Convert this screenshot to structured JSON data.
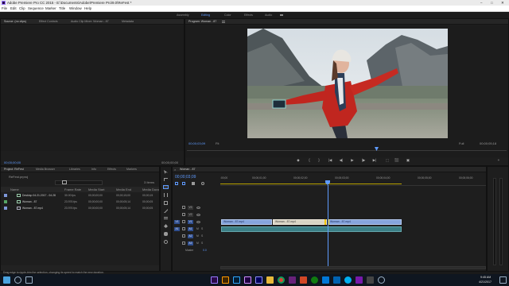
{
  "window": {
    "title": "Adobe Premiere Pro CC 2015 - E:\\Documents\\Adobe\\Premiere Pro\\9.0\\ReFest *",
    "controls": [
      "–",
      "□",
      "✕"
    ]
  },
  "menu": [
    "File",
    "Edit",
    "Clip",
    "Sequence",
    "Marker",
    "Title",
    "Window",
    "Help"
  ],
  "workspaces": [
    {
      "label": "Assembly",
      "active": false
    },
    {
      "label": "Editing",
      "active": true
    },
    {
      "label": "Color",
      "active": false
    },
    {
      "label": "Effects",
      "active": false
    },
    {
      "label": "Audio",
      "active": false
    }
  ],
  "source_monitor": {
    "tabs": [
      "Source: (no clips)",
      "Effect Controls",
      "Audio Clip Mixer: Woman - 87",
      "Metadata"
    ],
    "timecode_left": "00;00;00;00",
    "timecode_right": "00;00;00;00",
    "controls": [
      "◆",
      "{",
      "}",
      "|◀",
      "◀|",
      "▶",
      "|▶",
      "▶|",
      "⬚",
      "⬛",
      "▣",
      "+"
    ]
  },
  "program_monitor": {
    "tab": "Program: Woman - 87",
    "timecode_left": "00;00;03;09",
    "fit_label": "Fit",
    "quality_label": "Full",
    "timecode_right": "00;00;05;18",
    "controls": [
      "◆",
      "{",
      "}",
      "|◀",
      "◀|",
      "▶",
      "|▶",
      "▶|",
      "⬚",
      "⬛",
      "▣",
      "+"
    ]
  },
  "project_panel": {
    "tabs": [
      "Project: ReFest",
      "Media Browser",
      "Libraries",
      "Info",
      "Effects",
      "Markers"
    ],
    "project_file": "ReFest.prproj",
    "item_count": "3 Items",
    "columns": [
      "Name",
      "Frame Rate",
      "Media Start",
      "Media End",
      "Media Dura"
    ],
    "items": [
      {
        "name": "Desktop 04.21.2017 - 04.28",
        "frame_rate": "30.00 fps",
        "start": "00;00;00;00",
        "end": "00;00;15;00",
        "duration": "00;00;15"
      },
      {
        "name": "Woman - 87",
        "frame_rate": "23.976 fps",
        "start": "00;00;00;00",
        "end": "00;00;05;14",
        "duration": "00;00;05"
      },
      {
        "name": "Woman - 87.mp4",
        "frame_rate": "23.976 fps",
        "start": "00;00;00;00",
        "end": "00;00;05;14",
        "duration": "00;00;05"
      }
    ]
  },
  "timeline": {
    "tab": "Woman - 87",
    "timecode": "00;00;03;09",
    "ruler_labels": [
      ":00;00",
      "00;00;01;00",
      "00;00;02;00",
      "00;00;03;00",
      "00;00;04;00",
      "00;00;05;00",
      "00;00;06;00"
    ],
    "tracks": [
      {
        "label": "V3",
        "kind": "video"
      },
      {
        "label": "V2",
        "kind": "video"
      },
      {
        "label": "V1",
        "kind": "video"
      },
      {
        "label": "A1",
        "kind": "audio"
      },
      {
        "label": "A2",
        "kind": "audio"
      },
      {
        "label": "A3",
        "kind": "audio"
      }
    ],
    "master_label": "Master",
    "master_value": "0.0",
    "clips": [
      "Woman - 87.mp4",
      "Woman - 87.mp4",
      "Woman - 87.mp4"
    ]
  },
  "status_bar": {
    "text": "Drag edge to ripple-trim the selection, changing its speed to match the new duration."
  },
  "taskbar": {
    "time": "9:45 AM",
    "date": "4/21/2017"
  }
}
